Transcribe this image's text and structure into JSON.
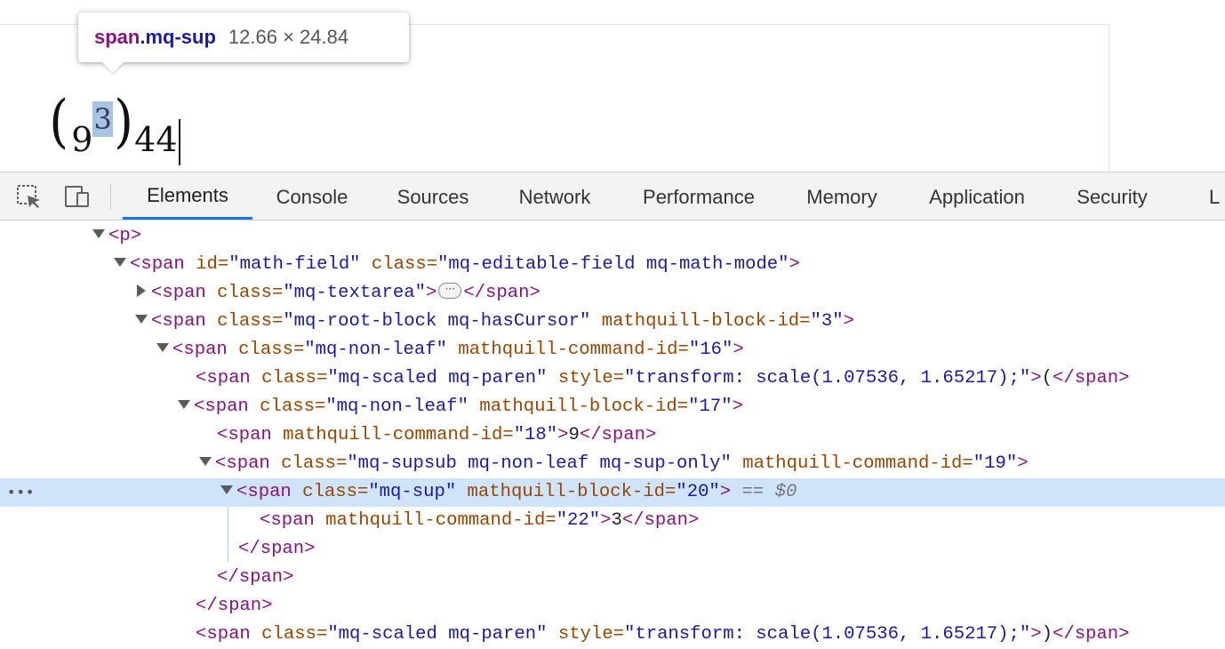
{
  "math": {
    "open_paren": "(",
    "base": "9",
    "sup": "3",
    "close_paren": ")",
    "after": "44"
  },
  "tooltip": {
    "tag": "span",
    "class": ".mq-sup",
    "size": "12.66 × 24.84"
  },
  "toolbar": {
    "tabs": [
      {
        "label": "Elements",
        "active": true
      },
      {
        "label": "Console"
      },
      {
        "label": "Sources"
      },
      {
        "label": "Network"
      },
      {
        "label": "Performance"
      },
      {
        "label": "Memory"
      },
      {
        "label": "Application"
      },
      {
        "label": "Security"
      },
      {
        "label": "L"
      }
    ],
    "icons": [
      "inspect-element-icon",
      "device-toolbar-icon"
    ]
  },
  "dom": {
    "gutter": "•••",
    "ellipsis": "···",
    "lines": [
      {
        "l0_tag": "<p>"
      },
      {
        "l1_open": "<span",
        "l1_a1": "id=",
        "l1_v1": "\"math-field\"",
        "l1_a2": "class=",
        "l1_v2": "\"mq-editable-field mq-math-mode\"",
        "l1_close": ">"
      },
      {
        "l2_open": "<span",
        "l2_a1": "class=",
        "l2_v1": "\"mq-textarea\"",
        "l2_close": ">",
        "l2_end": "</span>"
      },
      {
        "l3_open": "<span",
        "l3_a1": "class=",
        "l3_v1": "\"mq-root-block mq-hasCursor\"",
        "l3_a2": "mathquill-block-id=",
        "l3_v2": "\"3\"",
        "l3_close": ">"
      },
      {
        "l4_open": "<span",
        "l4_a1": "class=",
        "l4_v1": "\"mq-non-leaf\"",
        "l4_a2": "mathquill-command-id=",
        "l4_v2": "\"16\"",
        "l4_close": ">"
      },
      {
        "l5_open": "<span",
        "l5_a1": "class=",
        "l5_v1": "\"mq-scaled mq-paren\"",
        "l5_a2": "style=",
        "l5_v2": "\"transform: scale(1.07536, 1.65217);\"",
        "l5_close": ">",
        "l5_text": "(",
        "l5_end": "</span>"
      },
      {
        "l6_open": "<span",
        "l6_a1": "class=",
        "l6_v1": "\"mq-non-leaf\"",
        "l6_a2": "mathquill-block-id=",
        "l6_v2": "\"17\"",
        "l6_close": ">"
      },
      {
        "l7_open": "<span",
        "l7_a1": "mathquill-command-id=",
        "l7_v1": "\"18\"",
        "l7_close": ">",
        "l7_text": "9",
        "l7_end": "</span>"
      },
      {
        "l8_open": "<span",
        "l8_a1": "class=",
        "l8_v1": "\"mq-supsub mq-non-leaf mq-sup-only\"",
        "l8_a2": "mathquill-command-id=",
        "l8_v2": "\"19\"",
        "l8_close": ">"
      },
      {
        "l9_open": "<span",
        "l9_a1": "class=",
        "l9_v1": "\"mq-sup\"",
        "l9_a2": "mathquill-block-id=",
        "l9_v2": "\"20\"",
        "l9_close": ">",
        "l9_eq": "== $0"
      },
      {
        "l10_open": "<span",
        "l10_a1": "mathquill-command-id=",
        "l10_v1": "\"22\"",
        "l10_close": ">",
        "l10_text": "3",
        "l10_end": "</span>"
      },
      {
        "l11_end": "</span>"
      },
      {
        "l12_end": "</span>"
      },
      {
        "l13_end": "</span>"
      },
      {
        "l14_open": "<span",
        "l14_a1": "class=",
        "l14_v1": "\"mq-scaled mq-paren\"",
        "l14_a2": "style=",
        "l14_v2": "\"transform: scale(1.07536, 1.65217);\"",
        "l14_close": ">",
        "l14_text": ")",
        "l14_end": "</span>"
      }
    ]
  }
}
